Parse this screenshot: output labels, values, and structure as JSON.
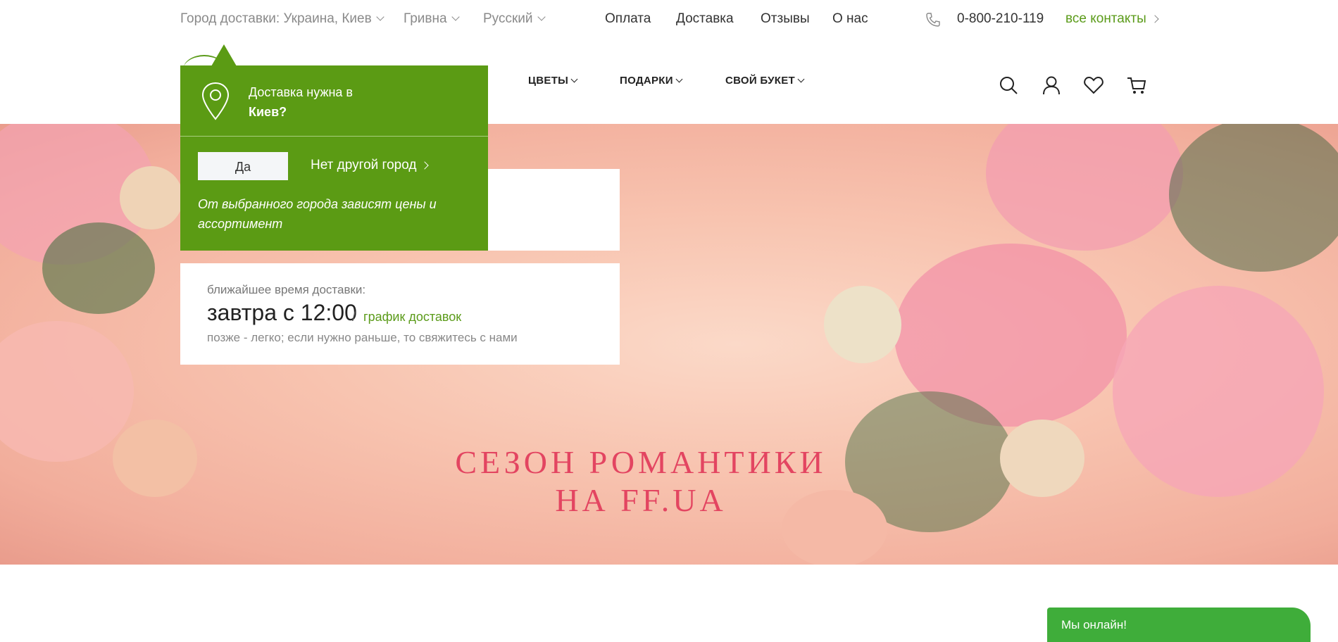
{
  "topbar": {
    "city": "Город доставки: Украина, Киев",
    "currency": "Гривна",
    "language": "Русский",
    "links": [
      "Оплата",
      "Доставка",
      "Отзывы",
      "О нас"
    ],
    "phone": "0-800-210-119",
    "contacts": "все контакты"
  },
  "nav": {
    "items": [
      "ЦВЕТЫ",
      "ПОДАРКИ",
      "СВОЙ БУКЕТ"
    ]
  },
  "popup": {
    "question_line1": "Доставка нужна в",
    "question_city": "Киев?",
    "yes_label": "Да",
    "no_label": "Нет другой город",
    "hint": "От выбранного города зависят цены и ассортимент"
  },
  "delivery": {
    "label": "ближайшее время доставки:",
    "time": "завтра с 12:00",
    "separator": "/",
    "schedule_link": "график доставок",
    "note": "позже - легко; если нужно раньше, то свяжитесь с нами"
  },
  "hero": {
    "title_line1": "СЕЗОН РОМАНТИКИ",
    "title_line2": "НА FF.UA"
  },
  "chat": {
    "label": "Мы онлайн!"
  },
  "colors": {
    "brand_green": "#5b9b14",
    "link_green": "#5b9b1a",
    "hero_title": "#e34561",
    "chat_green": "#3fad3a"
  }
}
